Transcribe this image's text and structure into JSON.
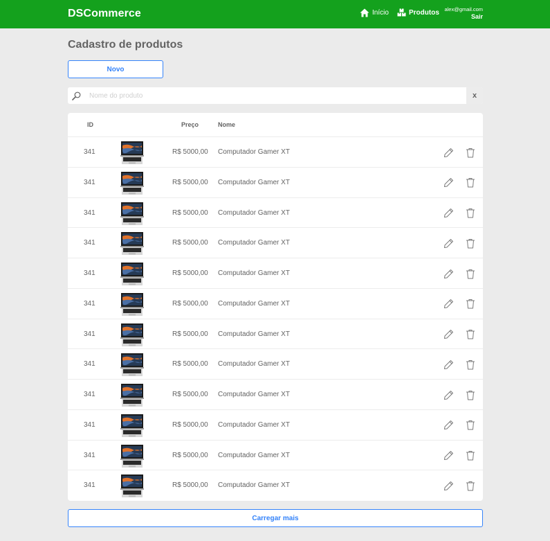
{
  "header": {
    "brand": "DSCommerce",
    "nav": {
      "home_label": "Início",
      "products_label": "Produtos"
    },
    "user": {
      "email": "alex@gmail.com",
      "logout_label": "Sair"
    },
    "color": "#14a11d"
  },
  "page": {
    "title": "Cadastro de produtos"
  },
  "toolbar": {
    "new_label": "Novo"
  },
  "search": {
    "placeholder": "Nome do produto",
    "value": "",
    "clear_label": "x"
  },
  "table": {
    "headers": {
      "id": "ID",
      "price": "Preço",
      "name": "Nome"
    },
    "rows": [
      {
        "id": "341",
        "price": "R$ 5000,00",
        "name": "Computador Gamer XT"
      },
      {
        "id": "341",
        "price": "R$ 5000,00",
        "name": "Computador Gamer XT"
      },
      {
        "id": "341",
        "price": "R$ 5000,00",
        "name": "Computador Gamer XT"
      },
      {
        "id": "341",
        "price": "R$ 5000,00",
        "name": "Computador Gamer XT"
      },
      {
        "id": "341",
        "price": "R$ 5000,00",
        "name": "Computador Gamer XT"
      },
      {
        "id": "341",
        "price": "R$ 5000,00",
        "name": "Computador Gamer XT"
      },
      {
        "id": "341",
        "price": "R$ 5000,00",
        "name": "Computador Gamer XT"
      },
      {
        "id": "341",
        "price": "R$ 5000,00",
        "name": "Computador Gamer XT"
      },
      {
        "id": "341",
        "price": "R$ 5000,00",
        "name": "Computador Gamer XT"
      },
      {
        "id": "341",
        "price": "R$ 5000,00",
        "name": "Computador Gamer XT"
      },
      {
        "id": "341",
        "price": "R$ 5000,00",
        "name": "Computador Gamer XT"
      },
      {
        "id": "341",
        "price": "R$ 5000,00",
        "name": "Computador Gamer XT"
      }
    ]
  },
  "footer": {
    "load_more_label": "Carregar mais"
  },
  "colors": {
    "accent": "#3483fa",
    "text": "#636363",
    "background": "#ebebeb"
  },
  "icons": {
    "home": "home-icon",
    "products": "boxes-icon",
    "search": "search-icon",
    "edit": "pencil-icon",
    "delete": "trash-icon",
    "product_image": "laptop-image"
  }
}
